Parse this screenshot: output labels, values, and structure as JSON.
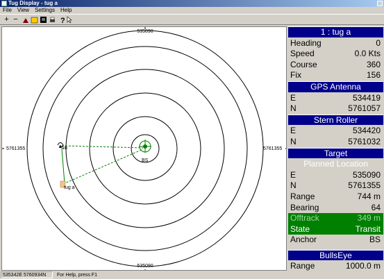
{
  "window": {
    "title": "Tug Display - tug a"
  },
  "menu": [
    "File",
    "View",
    "Settings",
    "Help"
  ],
  "toolbar": {
    "icons": [
      "zoom-in-icon",
      "zoom-out-icon",
      "chart-icon",
      "map-icon",
      "display-icon",
      "print-icon",
      "help-icon",
      "pointer-help-icon"
    ]
  },
  "map": {
    "top_label": "535090",
    "bottom_label": "535090",
    "left_label": "5761355",
    "right_label": "5761355",
    "center_label": "BS",
    "tug_label": "tug a",
    "anchor_label": "alb"
  },
  "panel": {
    "tug_header": "1 : tug a",
    "heading_label": "Heading",
    "heading_value": "0",
    "speed_label": "Speed",
    "speed_value": "0.0 Kts",
    "course_label": "Course",
    "course_value": "360",
    "fix_label": "Fix",
    "fix_value": "156",
    "gps_header": "GPS Antenna",
    "gps_e_label": "E",
    "gps_e_value": "534419",
    "gps_n_label": "N",
    "gps_n_value": "5761057",
    "stern_header": "Stern Roller",
    "stern_e_label": "E",
    "stern_e_value": "534420",
    "stern_n_label": "N",
    "stern_n_value": "5761032",
    "target_header": "Target",
    "planned_label": "Planned Location",
    "target_e_label": "E",
    "target_e_value": "535090",
    "target_n_label": "N",
    "target_n_value": "5761355",
    "range_label": "Range",
    "range_value": "744 m",
    "bearing_label": "Bearing",
    "bearing_value": "64",
    "offtrack_label": "Offtrack",
    "offtrack_value": "349 m",
    "state_label": "State",
    "state_value": "Transit",
    "anchor_label": "Anchor",
    "anchor_value": "BS",
    "bullseye_header": "BullsEye",
    "bullseye_range_label": "Range",
    "bullseye_range_value": "1000.0 m"
  },
  "status": {
    "coords": "535342E 5760934N",
    "help": "For Help, press F1"
  },
  "colors": {
    "header_bg": "#00008b",
    "state_bg": "#008000",
    "title_bg": "#0a246a"
  }
}
